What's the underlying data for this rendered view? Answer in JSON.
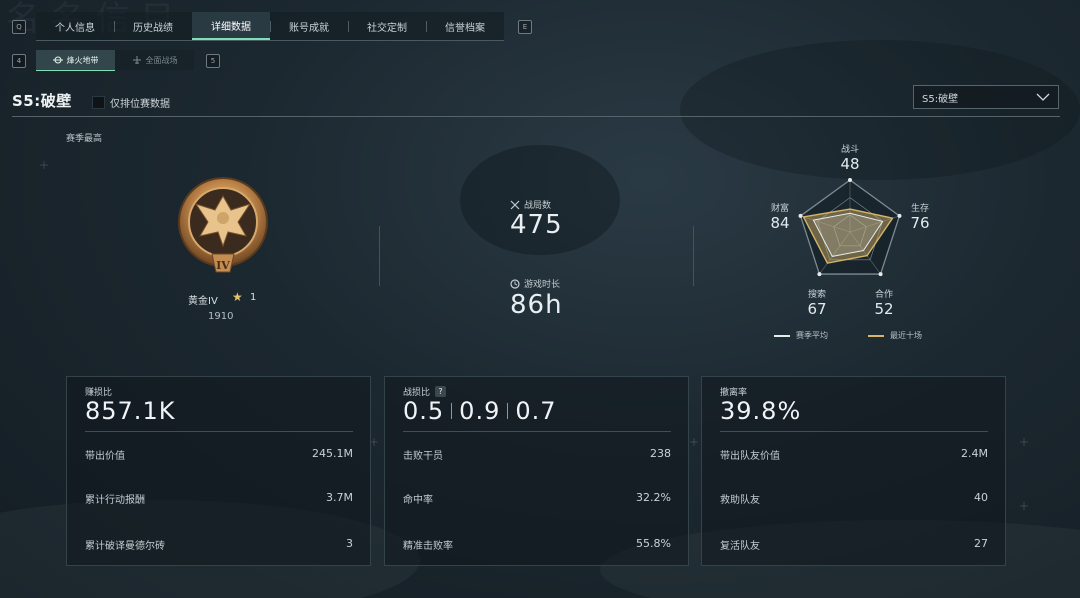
{
  "top_tabs": {
    "left_key": "Q",
    "right_key": "E",
    "items": [
      "个人信息",
      "历史战绩",
      "详细数据",
      "账号成就",
      "社交定制",
      "信誉档案"
    ],
    "active_index": 2
  },
  "sub_tabs": {
    "left_key": "4",
    "right_key": "5",
    "items": [
      {
        "label": "烽火地带",
        "icon": "crosshair-icon"
      },
      {
        "label": "全面战场",
        "icon": "aircraft-icon"
      }
    ],
    "active_index": 0
  },
  "season": {
    "title": "S5:破壁",
    "ranked_only_label": "仅排位赛数据",
    "ranked_only_checked": false,
    "dropdown_value": "S5:破壁"
  },
  "season_best": {
    "label": "赛季最高",
    "rank_name": "黄金IV",
    "rank_badge_numeral": "IV",
    "stars": "1",
    "points": "1910"
  },
  "center_stats": {
    "matches_label": "战局数",
    "matches_value": "475",
    "playtime_label": "游戏时长",
    "playtime_value": "86h"
  },
  "radar": {
    "axes": [
      {
        "label": "战斗",
        "value": "48"
      },
      {
        "label": "生存",
        "value": "76"
      },
      {
        "label": "合作",
        "value": "52"
      },
      {
        "label": "搜索",
        "value": "67"
      },
      {
        "label": "财富",
        "value": "84"
      }
    ],
    "season_avg_norm": [
      0.36,
      0.66,
      0.44,
      0.58,
      0.74
    ],
    "recent_norm": [
      0.44,
      0.86,
      0.56,
      0.74,
      0.94
    ],
    "legend_avg": "赛季平均",
    "legend_recent": "最近十场",
    "colors": {
      "avg": "#e6eaec",
      "recent": "#d6b468"
    }
  },
  "cards": {
    "profit": {
      "title": "赚损比",
      "big": "857.1K",
      "rows": [
        {
          "label": "带出价值",
          "value": "245.1M"
        },
        {
          "label": "累计行动报酬",
          "value": "3.7M"
        },
        {
          "label": "累计破译曼德尔砖",
          "value": "3"
        }
      ]
    },
    "kd": {
      "title": "战损比",
      "help": "?",
      "values": [
        "0.5",
        "0.9",
        "0.7"
      ],
      "rows": [
        {
          "label": "击败干员",
          "value": "238"
        },
        {
          "label": "命中率",
          "value": "32.2%"
        },
        {
          "label": "精准击败率",
          "value": "55.8%"
        }
      ]
    },
    "extract": {
      "title": "撤离率",
      "big": "39.8%",
      "rows": [
        {
          "label": "带出队友价值",
          "value": "2.4M"
        },
        {
          "label": "救助队友",
          "value": "40"
        },
        {
          "label": "复活队友",
          "value": "27"
        }
      ]
    }
  },
  "accent_color": "#7fe0b8"
}
